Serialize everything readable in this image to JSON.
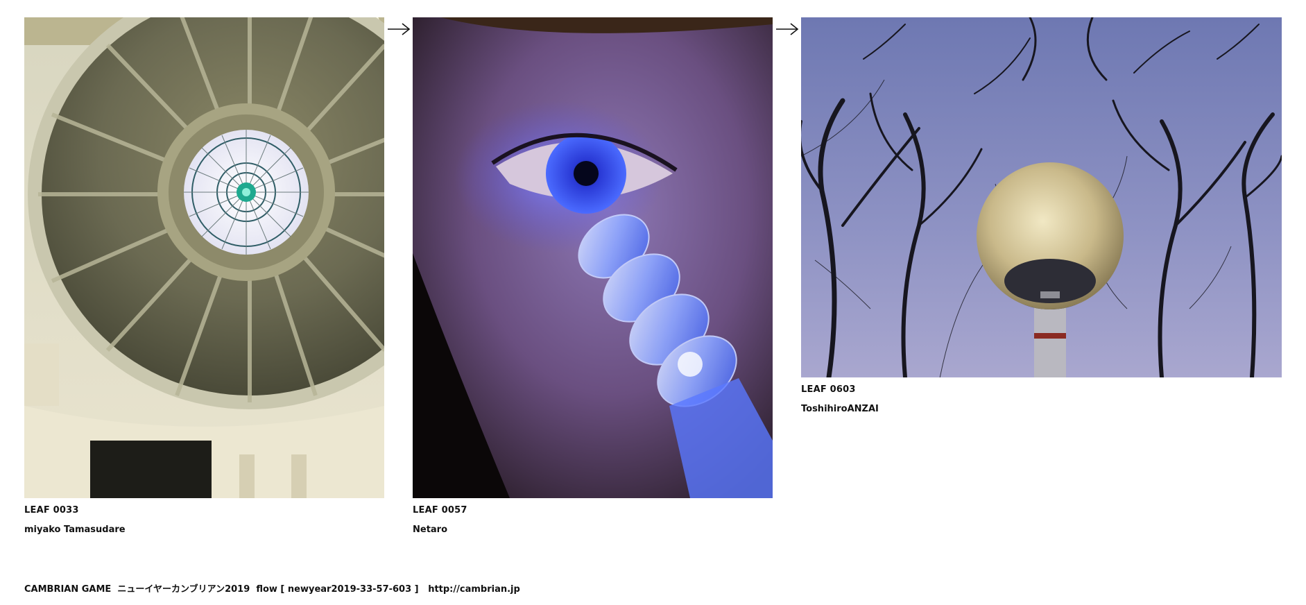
{
  "leaves": [
    {
      "id": "LEAF 0033",
      "author": "miyako Tamasudare",
      "photo": "dome-ceiling-photo"
    },
    {
      "id": "LEAF 0057",
      "author": "Netaro",
      "photo": "eye-blue-light-photo"
    },
    {
      "id": "LEAF 0603",
      "author": "ToshihiroANZAI",
      "photo": "street-lamp-trees-photo"
    }
  ],
  "footer": {
    "game": "CAMBRIAN GAME",
    "title": "ニューイヤーカンブリアン2019",
    "flow": "flow [ newyear2019-33-57-603 ]",
    "url": "http://cambrian.jp"
  },
  "colors": {
    "text": "#111111",
    "background": "#ffffff"
  }
}
